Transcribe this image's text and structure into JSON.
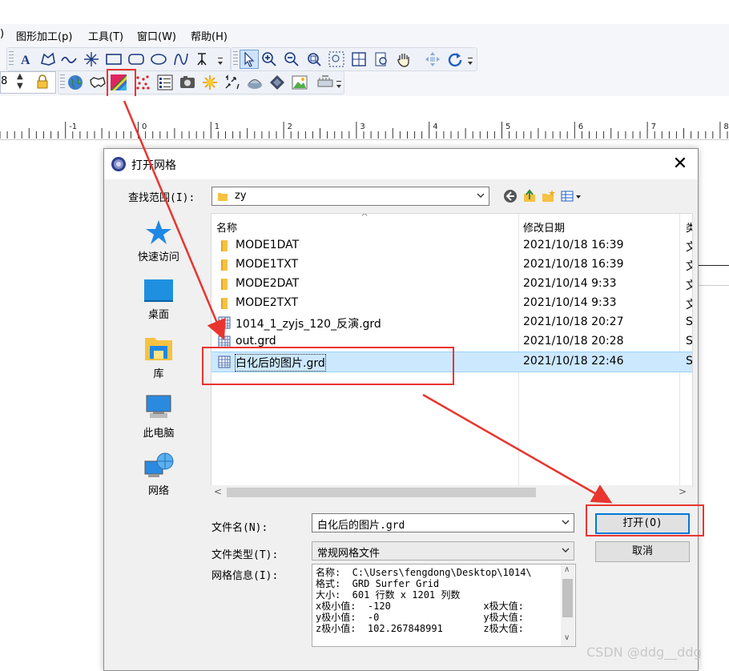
{
  "menu": {
    "partial": ")",
    "items": [
      "图形加工(p)",
      "工具(T)",
      "窗口(W)",
      "帮助(H)"
    ]
  },
  "toolbar": {
    "row1_icons": [
      "text-icon",
      "polygon-icon",
      "curve-icon",
      "sparkle-icon",
      "rectangle-icon",
      "rounded-rectangle-icon",
      "ellipse-icon",
      "spline-icon",
      "reshape-icon",
      "select-arrow-icon",
      "zoom-in-icon",
      "zoom-out-icon",
      "zoom-fit-icon",
      "zoom-rect-icon",
      "zoom-page-icon",
      "zoom-actual-icon",
      "pan-hand-icon",
      "move-icon",
      "redraw-icon"
    ],
    "row2_icons": [
      "globe-icon",
      "map-outline-icon",
      "contour-map-icon",
      "post-map-icon",
      "classed-post-icon",
      "image-map-icon",
      "shaded-relief-icon",
      "vector-map-icon",
      "wireframe-icon",
      "surface-icon",
      "base-map-icon",
      "3d-view-icon"
    ],
    "partial_value": "8"
  },
  "ruler": {
    "labels": [
      "-1",
      "0",
      "1",
      "2",
      "3",
      "4",
      "5",
      "6",
      "7",
      "8"
    ]
  },
  "dialog": {
    "title": "打开网格",
    "look_in_label": "查找范围(I):",
    "look_in_value": "zy",
    "places": [
      "快速访问",
      "桌面",
      "库",
      "此电脑",
      "网络"
    ],
    "columns": {
      "name": "名称",
      "date": "修改日期",
      "type": "类"
    },
    "files": [
      {
        "name": "MODE1DAT",
        "date": "2021/10/18 16:39",
        "type": "文",
        "kind": "folder"
      },
      {
        "name": "MODE1TXT",
        "date": "2021/10/18 16:39",
        "type": "文",
        "kind": "folder"
      },
      {
        "name": "MODE2DAT",
        "date": "2021/10/14 9:33",
        "type": "文",
        "kind": "folder"
      },
      {
        "name": "MODE2TXT",
        "date": "2021/10/14 9:33",
        "type": "文",
        "kind": "folder"
      },
      {
        "name": "1014_1_zyjs_120_反演.grd",
        "date": "2021/10/18 20:27",
        "type": "S",
        "kind": "grid"
      },
      {
        "name": "out.grd",
        "date": "2021/10/18 20:28",
        "type": "S",
        "kind": "grid"
      },
      {
        "name": "白化后的图片.grd",
        "date": "2021/10/18 22:46",
        "type": "S",
        "kind": "grid",
        "selected": true
      }
    ],
    "filename_label": "文件名(N):",
    "filename_value": "白化后的图片.grd",
    "filetype_label": "文件类型(T):",
    "filetype_value": "常规网格文件",
    "gridinfo_label": "网格信息(I):",
    "gridinfo_lines": [
      "名称:  C:\\Users\\fengdong\\Desktop\\1014\\",
      "格式:  GRD Surfer Grid",
      "大小:  601 行数 x 1201 列数",
      "x极小值:  -120                x极大值:",
      "y极小值:  -0                  y极大值:",
      "z极小值:  102.267848991       z极大值:"
    ],
    "open_button": "打开(O)",
    "cancel_button": "取消"
  },
  "watermark": "CSDN @ddg__ddg",
  "colors": {
    "highlight_red": "#e8352f",
    "selection_bg": "#cce8ff",
    "folder_yellow": "#f5c242",
    "accent_blue": "#0078d7"
  }
}
